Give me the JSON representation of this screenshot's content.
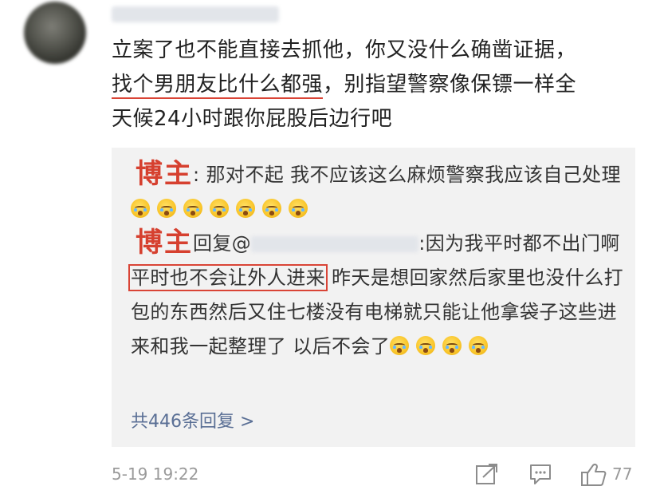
{
  "comment": {
    "line1": "立案了也不能直接去抓他，你又没什么确凿证据，",
    "line2_highlight": "找个男朋友比什么都强",
    "line2_rest": "，别指望警察像保镖一样全",
    "line3": "天候24小时跟你屁股后边行吧"
  },
  "replies": [
    {
      "author": "博主",
      "text": ": 那对不起  我不应该这么麻烦警察我应该自己处理"
    },
    {
      "author": "博主",
      "reply_prefix": "回复@",
      "text_a": ":因为我平时都不出门啊",
      "text_highlight": "平时也不会让外人进来",
      "text_b": " 昨天是想回家然后家里也没什么打包的东西然后又住七楼没有电梯就只能让他拿袋子这些进来和我一起整理了  以后不会了"
    }
  ],
  "more_replies": "共446条回复 >",
  "footer": {
    "timestamp": "5-19 19:22",
    "like_count": "77"
  },
  "icons": {
    "share": "share-icon",
    "comment": "comment-icon",
    "like": "thumbs-up-icon",
    "emoji": "crying-face-emoji"
  },
  "colors": {
    "highlight_red": "#d94436",
    "link_blue": "#5a6f95"
  }
}
